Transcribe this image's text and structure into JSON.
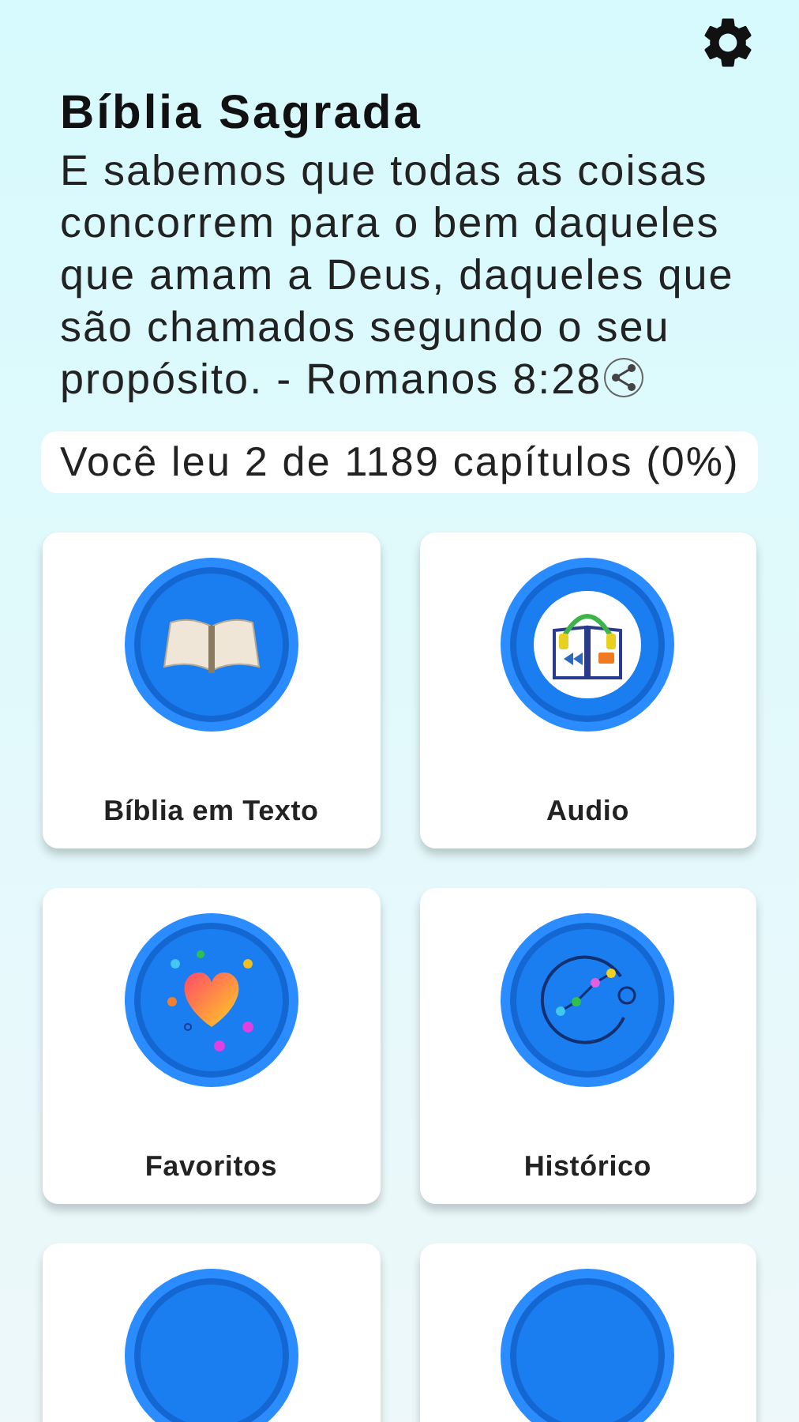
{
  "header": {
    "title": "Bíblia Sagrada",
    "verse": "E sabemos que todas as coisas concorrem para o bem daqueles que amam a Deus, daqueles que são chamados segundo o seu propósito. - Romanos 8:28"
  },
  "progress": {
    "text": "Você leu 2 de 1189 capítulos (0%)"
  },
  "menu": [
    {
      "kind": "book",
      "label": "Bíblia em Texto"
    },
    {
      "kind": "audio",
      "label": "Audio"
    },
    {
      "kind": "heart",
      "label": "Favoritos"
    },
    {
      "kind": "history",
      "label": "Histórico"
    },
    {
      "kind": "partial"
    },
    {
      "kind": "partial"
    }
  ]
}
